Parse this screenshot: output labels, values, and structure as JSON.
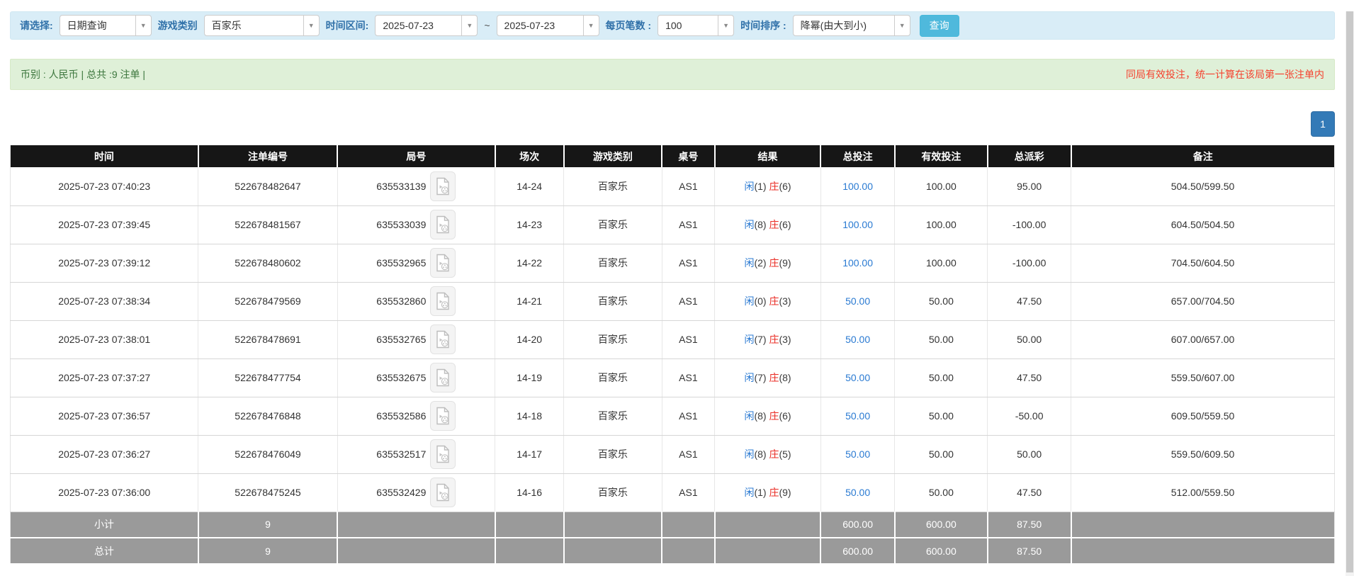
{
  "filter_bar": {
    "select_label": "请选择:",
    "select_value": "日期查询",
    "game_category_label": "游戏类别",
    "game_category_value": "百家乐",
    "time_range_label": "时间区间:",
    "date_from": "2025-07-23",
    "tilde": "~",
    "date_to": "2025-07-23",
    "page_size_label": "每页笔数 :",
    "page_size_value": "100",
    "sort_label": "时间排序 :",
    "sort_value": "降幂(由大到小)",
    "query_button_label": "查询"
  },
  "summary_bar": {
    "left_text": "币别 : 人民币 | 总共 :9 注单 |",
    "right_notice": "同局有效投注，统一计算在该局第一张注单内"
  },
  "pagination": {
    "current_page": "1"
  },
  "colors": {
    "filter_bg": "#d9edf7",
    "filter_label_blue": "#3071a9",
    "query_button_cyan": "#4fb9dc",
    "summary_bg": "#dff0d8",
    "summary_green": "#3c763d",
    "notice_red": "#f5412e",
    "header_bg": "#161616",
    "footer_gray": "#9a9a9a",
    "link_blue": "#2a7ad2",
    "result_red": "#e92a22",
    "loss_red": "#f00000",
    "pagination_blue": "#337ab7"
  },
  "table": {
    "headers": [
      "时间",
      "注单编号",
      "局号",
      "场次",
      "游戏类别",
      "桌号",
      "结果",
      "总投注",
      "有效投注",
      "总派彩",
      "备注"
    ],
    "rows": [
      {
        "time": "2025-07-23 07:40:23",
        "bet_id": "522678482647",
        "round_id": "635533139",
        "session": "14-24",
        "game": "百家乐",
        "table_no": "AS1",
        "player_label": "闲",
        "player_score": "(1)",
        "banker_label": "庄",
        "banker_score": "(6)",
        "total_bet": "100.00",
        "valid_bet": "100.00",
        "payout": "95.00",
        "remark": "504.50/599.50"
      },
      {
        "time": "2025-07-23 07:39:45",
        "bet_id": "522678481567",
        "round_id": "635533039",
        "session": "14-23",
        "game": "百家乐",
        "table_no": "AS1",
        "player_label": "闲",
        "player_score": "(8)",
        "banker_label": "庄",
        "banker_score": "(6)",
        "total_bet": "100.00",
        "valid_bet": "100.00",
        "payout": "-100.00",
        "remark": "604.50/504.50"
      },
      {
        "time": "2025-07-23 07:39:12",
        "bet_id": "522678480602",
        "round_id": "635532965",
        "session": "14-22",
        "game": "百家乐",
        "table_no": "AS1",
        "player_label": "闲",
        "player_score": "(2)",
        "banker_label": "庄",
        "banker_score": "(9)",
        "total_bet": "100.00",
        "valid_bet": "100.00",
        "payout": "-100.00",
        "remark": "704.50/604.50"
      },
      {
        "time": "2025-07-23 07:38:34",
        "bet_id": "522678479569",
        "round_id": "635532860",
        "session": "14-21",
        "game": "百家乐",
        "table_no": "AS1",
        "player_label": "闲",
        "player_score": "(0)",
        "banker_label": "庄",
        "banker_score": "(3)",
        "total_bet": "50.00",
        "valid_bet": "50.00",
        "payout": "47.50",
        "remark": "657.00/704.50"
      },
      {
        "time": "2025-07-23 07:38:01",
        "bet_id": "522678478691",
        "round_id": "635532765",
        "session": "14-20",
        "game": "百家乐",
        "table_no": "AS1",
        "player_label": "闲",
        "player_score": "(7)",
        "banker_label": "庄",
        "banker_score": "(3)",
        "total_bet": "50.00",
        "valid_bet": "50.00",
        "payout": "50.00",
        "remark": "607.00/657.00"
      },
      {
        "time": "2025-07-23 07:37:27",
        "bet_id": "522678477754",
        "round_id": "635532675",
        "session": "14-19",
        "game": "百家乐",
        "table_no": "AS1",
        "player_label": "闲",
        "player_score": "(7)",
        "banker_label": "庄",
        "banker_score": "(8)",
        "total_bet": "50.00",
        "valid_bet": "50.00",
        "payout": "47.50",
        "remark": "559.50/607.00"
      },
      {
        "time": "2025-07-23 07:36:57",
        "bet_id": "522678476848",
        "round_id": "635532586",
        "session": "14-18",
        "game": "百家乐",
        "table_no": "AS1",
        "player_label": "闲",
        "player_score": "(8)",
        "banker_label": "庄",
        "banker_score": "(6)",
        "total_bet": "50.00",
        "valid_bet": "50.00",
        "payout": "-50.00",
        "remark": "609.50/559.50"
      },
      {
        "time": "2025-07-23 07:36:27",
        "bet_id": "522678476049",
        "round_id": "635532517",
        "session": "14-17",
        "game": "百家乐",
        "table_no": "AS1",
        "player_label": "闲",
        "player_score": "(8)",
        "banker_label": "庄",
        "banker_score": "(5)",
        "total_bet": "50.00",
        "valid_bet": "50.00",
        "payout": "50.00",
        "remark": "559.50/609.50"
      },
      {
        "time": "2025-07-23 07:36:00",
        "bet_id": "522678475245",
        "round_id": "635532429",
        "session": "14-16",
        "game": "百家乐",
        "table_no": "AS1",
        "player_label": "闲",
        "player_score": "(1)",
        "banker_label": "庄",
        "banker_score": "(9)",
        "total_bet": "50.00",
        "valid_bet": "50.00",
        "payout": "47.50",
        "remark": "512.00/559.50"
      }
    ],
    "footer_rows": [
      {
        "label": "小计",
        "count": "9",
        "total_bet": "600.00",
        "valid_bet": "600.00",
        "payout": "87.50"
      },
      {
        "label": "总计",
        "count": "9",
        "total_bet": "600.00",
        "valid_bet": "600.00",
        "payout": "87.50"
      }
    ]
  }
}
